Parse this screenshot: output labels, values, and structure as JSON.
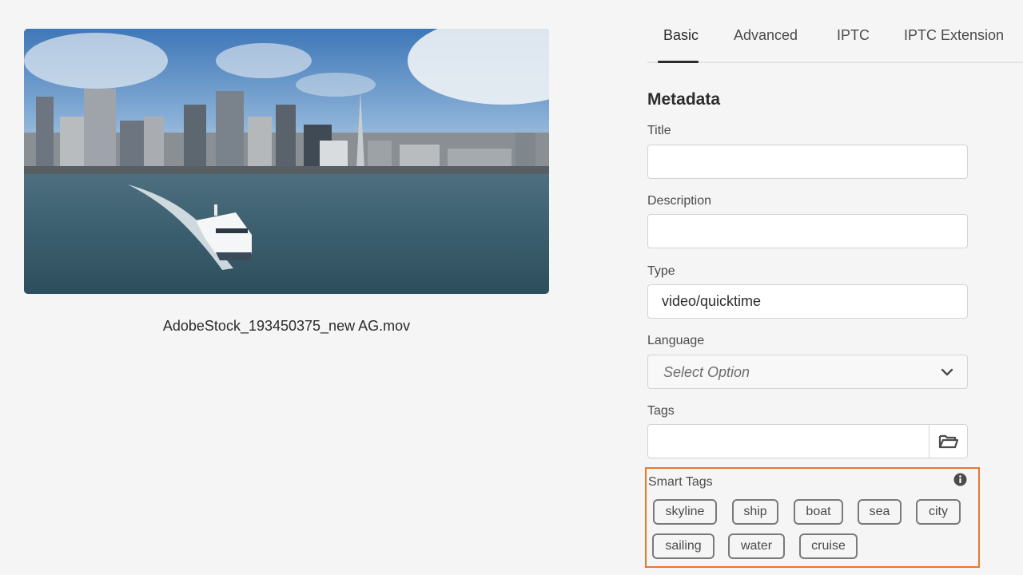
{
  "asset": {
    "filename": "AdobeStock_193450375_new AG.mov"
  },
  "tabs": [
    {
      "label": "Basic",
      "active": true
    },
    {
      "label": "Advanced",
      "active": false
    },
    {
      "label": "IPTC",
      "active": false
    },
    {
      "label": "IPTC Extension",
      "active": false
    }
  ],
  "metadata": {
    "section_title": "Metadata",
    "title": {
      "label": "Title",
      "value": ""
    },
    "description": {
      "label": "Description",
      "value": ""
    },
    "type": {
      "label": "Type",
      "value": "video/quicktime"
    },
    "language": {
      "label": "Language",
      "selected": "Select Option"
    },
    "tags": {
      "label": "Tags",
      "value": ""
    },
    "smart_tags": {
      "label": "Smart Tags",
      "items": [
        "skyline",
        "ship",
        "boat",
        "sea",
        "city",
        "sailing",
        "water",
        "cruise"
      ]
    }
  },
  "icons": {
    "select_chevron": "chevron-down-icon",
    "tags_browse": "folder-open-icon",
    "smart_info": "info-icon"
  },
  "colors": {
    "highlight_border": "#e8772e",
    "chip_border": "#7a7a7a",
    "background": "#f5f5f5"
  }
}
